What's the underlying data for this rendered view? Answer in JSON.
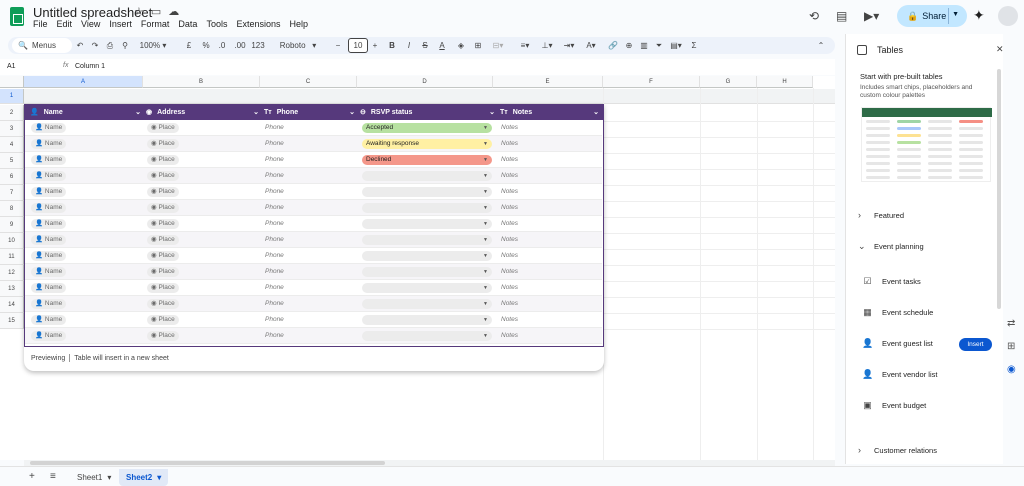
{
  "app": {
    "doc_title": "Untitled spreadsheet",
    "menu": [
      "File",
      "Edit",
      "View",
      "Insert",
      "Format",
      "Data",
      "Tools",
      "Extensions",
      "Help"
    ],
    "share_label": "Share"
  },
  "toolbar": {
    "menus_label": "Menus",
    "zoom": "100%",
    "currency": "£",
    "percent": "%",
    "dec_decrease": ".0",
    "dec_increase": ".00",
    "number_format": "123",
    "font": "Roboto",
    "font_size": "10"
  },
  "formula_bar": {
    "cell_ref": "A1",
    "fx": "fx",
    "value": "Column 1"
  },
  "grid": {
    "columns": [
      "A",
      "B",
      "C",
      "D",
      "E",
      "F",
      "G",
      "H"
    ],
    "rows": [
      "1",
      "2",
      "3",
      "4",
      "5",
      "6",
      "7",
      "8",
      "9",
      "10",
      "11",
      "12",
      "13",
      "14",
      "15"
    ]
  },
  "table_preview": {
    "headers": [
      {
        "icon": "person-icon",
        "glyph": "👤",
        "label": "Name"
      },
      {
        "icon": "place-icon",
        "glyph": "◉",
        "label": "Address"
      },
      {
        "icon": "text-icon",
        "glyph": "Tт",
        "label": "Phone"
      },
      {
        "icon": "dropdown-icon",
        "glyph": "⊖",
        "label": "RSVP status"
      },
      {
        "icon": "text-icon",
        "glyph": "Tт",
        "label": "Notes"
      }
    ],
    "name_placeholder": "Name",
    "place_placeholder": "Place",
    "phone_placeholder": "Phone",
    "notes_placeholder": "Notes",
    "statuses": [
      {
        "label": "Accepted",
        "color": "#b7e1a1"
      },
      {
        "label": "Awaiting response",
        "color": "#fff0a3"
      },
      {
        "label": "Declined",
        "color": "#f4978a"
      },
      {
        "label": "",
        "color": ""
      },
      {
        "label": "",
        "color": ""
      },
      {
        "label": "",
        "color": ""
      },
      {
        "label": "",
        "color": ""
      },
      {
        "label": "",
        "color": ""
      },
      {
        "label": "",
        "color": ""
      },
      {
        "label": "",
        "color": ""
      },
      {
        "label": "",
        "color": ""
      },
      {
        "label": "",
        "color": ""
      },
      {
        "label": "",
        "color": ""
      },
      {
        "label": "",
        "color": ""
      }
    ],
    "footer_status": "Previewing",
    "footer_note": "Table will insert in a new sheet",
    "header_color": "#56397c"
  },
  "panel": {
    "title": "Tables",
    "heading": "Start with pre-built tables",
    "subtext": "Includes smart chips, placeholders and custom colour palettes",
    "sections": [
      {
        "label": "Featured",
        "expanded": false
      },
      {
        "label": "Event planning",
        "expanded": true
      },
      {
        "label": "Customer relations",
        "expanded": false
      }
    ],
    "items": [
      {
        "icon": "checklist-icon",
        "glyph": "☑",
        "label": "Event tasks"
      },
      {
        "icon": "calendar-icon",
        "glyph": "▦",
        "label": "Event schedule"
      },
      {
        "icon": "person-icon",
        "glyph": "👤",
        "label": "Event guest list"
      },
      {
        "icon": "person-icon",
        "glyph": "👤",
        "label": "Event vendor list"
      },
      {
        "icon": "money-icon",
        "glyph": "▣",
        "label": "Event budget"
      }
    ],
    "insert_label": "Insert"
  },
  "sheets": {
    "tabs": [
      {
        "label": "Sheet1",
        "active": false
      },
      {
        "label": "Sheet2",
        "active": true
      }
    ]
  }
}
